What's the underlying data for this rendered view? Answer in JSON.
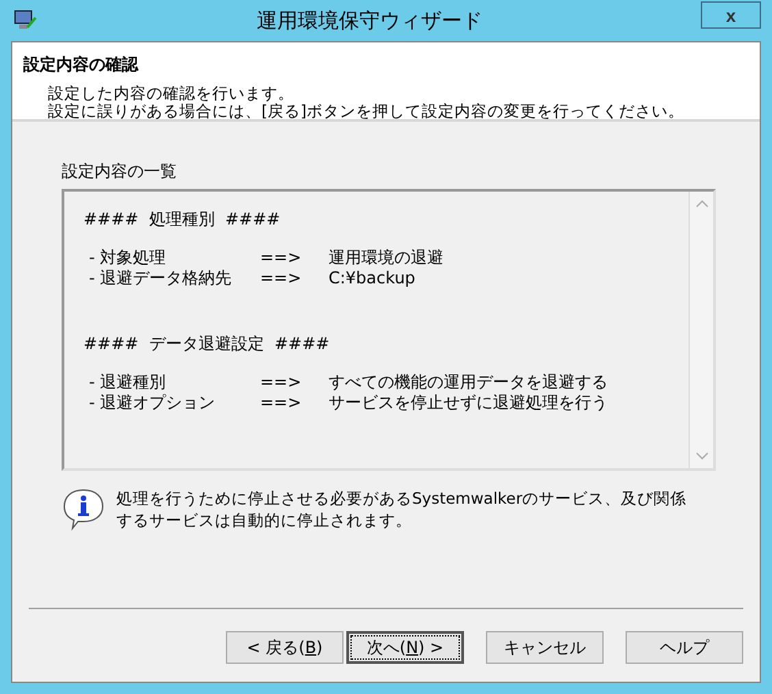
{
  "window": {
    "title": "運用環境保守ウィザード",
    "close": "x"
  },
  "header": {
    "title": "設定内容の確認",
    "lines": [
      "設定した内容の確認を行います。",
      "設定に誤りがある場合には、[戻る]ボタンを押して設定内容の変更を行ってください。"
    ]
  },
  "list_label": "設定内容の一覧",
  "sections": [
    {
      "heading": "####  処理種別  ####",
      "items": [
        {
          "label": "- 対象処理",
          "arrow": "==>",
          "value": "運用環境の退避"
        },
        {
          "label": "- 退避データ格納先",
          "arrow": "==>",
          "value": "C:¥backup"
        }
      ]
    },
    {
      "heading": "####  データ退避設定  ####",
      "items": [
        {
          "label": "- 退避種別",
          "arrow": "==>",
          "value": "すべての機能の運用データを退避する"
        },
        {
          "label": "- 退避オプション",
          "arrow": "==>",
          "value": "サービスを停止せずに退避処理を行う"
        }
      ]
    }
  ],
  "info": "処理を行うために停止させる必要があるSystemwalkerのサービス、及び関係するサービスは自動的に停止されます。",
  "buttons": [
    {
      "before": "< 戻る(",
      "key": "B",
      "after": ")",
      "default": false
    },
    {
      "before": "次へ(",
      "key": "N",
      "after": ") >",
      "default": true
    },
    {
      "before": "キャンセル",
      "default": false
    },
    {
      "before": "ヘルプ",
      "default": false
    }
  ]
}
